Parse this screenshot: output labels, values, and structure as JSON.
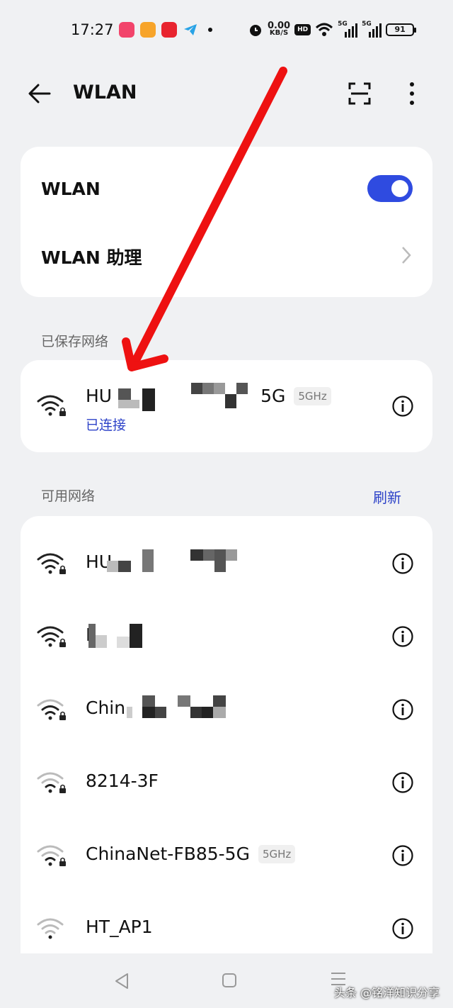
{
  "status_bar": {
    "time": "17:27",
    "speed_value": "0.00",
    "speed_unit": "KB/S",
    "hd_label": "HD",
    "signal1_label": "5G",
    "signal2_label": "5G",
    "battery": "91"
  },
  "header": {
    "title": "WLAN"
  },
  "settings": {
    "wlan_label": "WLAN",
    "wlan_enabled": true,
    "assistant_label": "WLAN 助理"
  },
  "saved_section": {
    "title": "已保存网络",
    "networks": [
      {
        "ssid_start": "HU",
        "ssid_end": "5G",
        "band": "5GHz",
        "status": "已连接",
        "signal": 4,
        "locked": true
      }
    ]
  },
  "available_section": {
    "title": "可用网络",
    "refresh_label": "刷新",
    "networks": [
      {
        "ssid": "HU",
        "signal": 4,
        "locked": true
      },
      {
        "ssid": "I",
        "signal": 4,
        "locked": true
      },
      {
        "ssid": "Chin",
        "signal": 3,
        "locked": true
      },
      {
        "ssid": "8214-3F",
        "signal": 2,
        "locked": true
      },
      {
        "ssid": "ChinaNet-FB85-5G",
        "band": "5GHz",
        "signal": 2,
        "locked": true
      },
      {
        "ssid": "HT_AP1",
        "signal": 1,
        "locked": false
      }
    ]
  },
  "watermark": "头条 @铭洋知识分享",
  "colors": {
    "accent": "#2f4be0",
    "link": "#2d42c8",
    "background": "#f0f1f3",
    "arrow": "#ee1111"
  },
  "icons": [
    "back-arrow-icon",
    "scan-icon",
    "more-icon",
    "chevron-right-icon",
    "wifi-icon",
    "lock-icon",
    "info-icon",
    "nav-back-icon",
    "nav-home-icon",
    "nav-menu-icon"
  ]
}
